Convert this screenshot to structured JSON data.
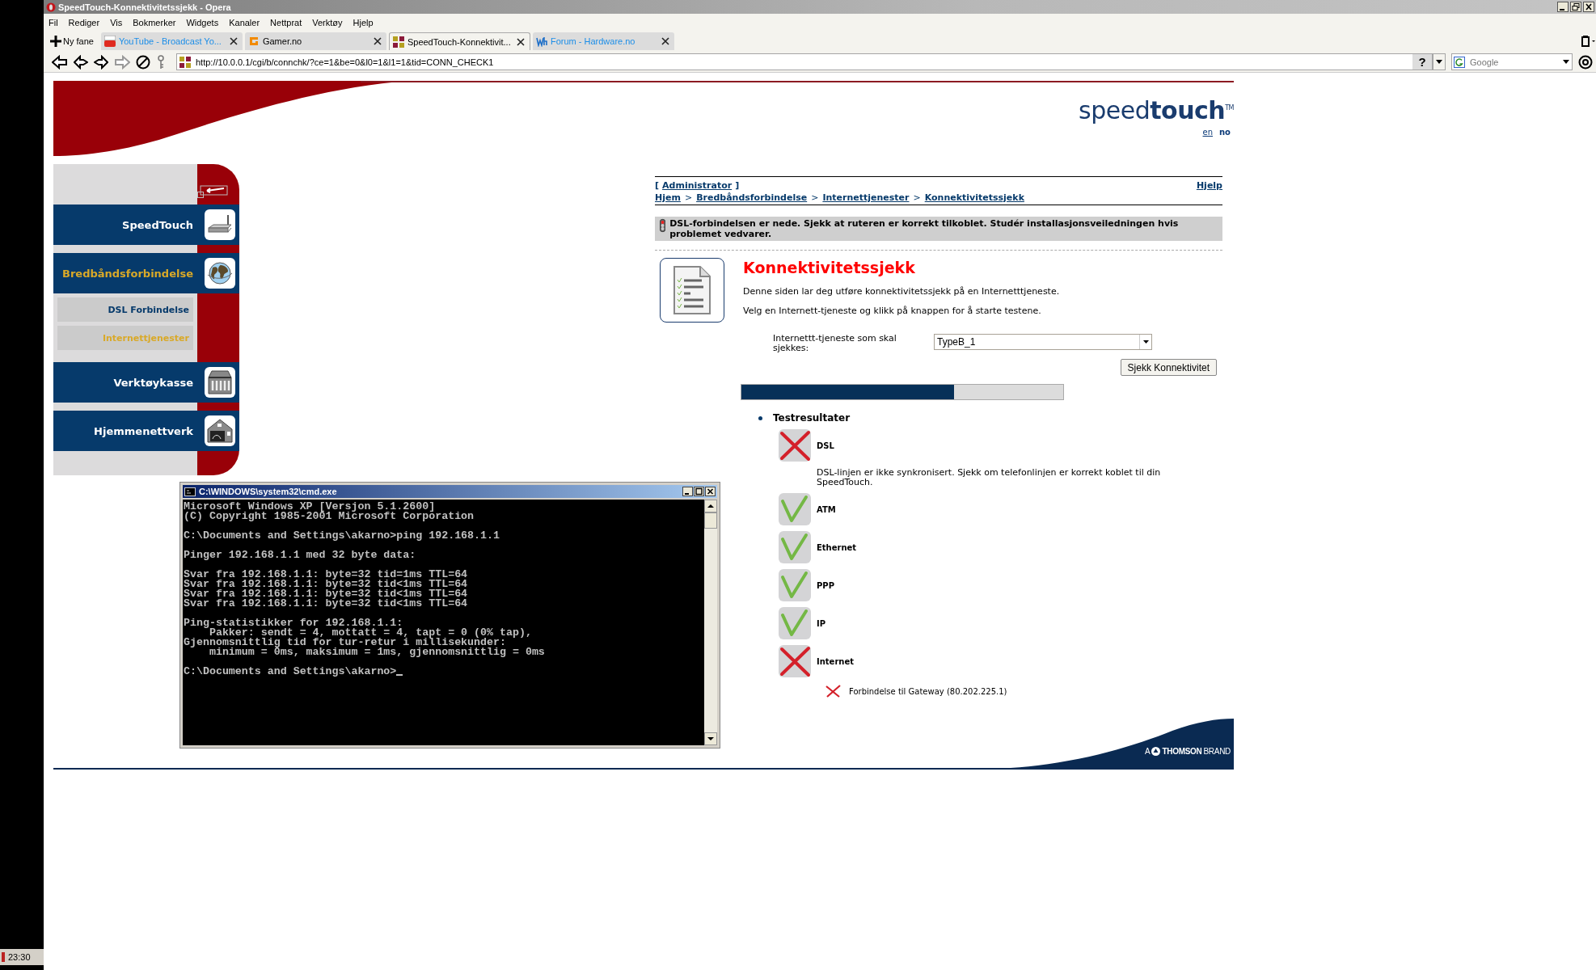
{
  "taskbar": {
    "clock": "23:30"
  },
  "window": {
    "title": "SpeedTouch-Konnektivitetssjekk - Opera"
  },
  "menu": [
    "Fil",
    "Rediger",
    "Vis",
    "Bokmerker",
    "Widgets",
    "Kanaler",
    "Nettprat",
    "Verktøy",
    "Hjelp"
  ],
  "new_tab": "Ny fane",
  "tabs": [
    {
      "label": "YouTube - Broadcast Yo...",
      "selected": false,
      "color": "#1c8ee8"
    },
    {
      "label": "Gamer.no",
      "selected": false,
      "color": "#000000"
    },
    {
      "label": "SpeedTouch-Konnektivit...",
      "selected": true,
      "color": "#000000"
    },
    {
      "label": "Forum - Hardware.no",
      "selected": false,
      "color": "#1c8ee8"
    }
  ],
  "address": {
    "url": "http://10.0.0.1/cgi/b/connchk/?ce=1&be=0&l0=1&l1=1&tid=CONN_CHECK1",
    "help": "?"
  },
  "search": {
    "placeholder": "Google"
  },
  "page": {
    "logo": "speed**touch**$^{TM}$",
    "languages": [
      {
        "label": "en",
        "selected": false
      },
      {
        "label": "no",
        "selected": true
      }
    ],
    "sidebar": {
      "items": [
        {
          "label": "SpeedTouch",
          "selected": false
        },
        {
          "label": "Bredbåndsforbindelse",
          "selected": true,
          "children": [
            {
              "label": "DSL Forbindelse",
              "selected": false
            },
            {
              "label": "Internettjenester",
              "selected": true
            }
          ]
        },
        {
          "label": "Verktøykasse",
          "selected": false
        },
        {
          "label": "Hjemmenettverk",
          "selected": false
        }
      ]
    },
    "account": {
      "open": "[",
      "name": "Administrator",
      "close": "]"
    },
    "help_link": "Hjelp",
    "breadcrumb": [
      {
        "label": "Hjem"
      },
      {
        "separator": ">",
        "label": "Bredbåndsforbindelse"
      },
      {
        "separator": ">",
        "label": "Internettjenester"
      },
      {
        "separator": ">",
        "label": "Konnektivitetssjekk"
      }
    ],
    "alert": "DSL-forbindelsen er nede. Sjekk at ruteren er korrekt tilkoblet. Studér installasjonsveiledningen hvis problemet vedvarer.",
    "title": "Konnektivitetssjekk",
    "intro": [
      "Denne siden lar deg utføre konnektivitetssjekk på en Internetttjeneste.",
      "Velg en Internett-tjeneste og klikk på knappen for å starte testene."
    ],
    "service_field": {
      "label": "Internettt-tjeneste som skal sjekkes:",
      "value": "TypeB_1"
    },
    "check_button": "Sjekk Konnektivitet",
    "progress": {
      "level": 0.66
    },
    "results": {
      "heading": "Testresultater",
      "items": [
        {
          "name": "DSL",
          "passed": false,
          "note": "DSL-linjen er ikke synkronisert. Sjekk om telefonlinjen er korrekt koblet til din SpeedTouch."
        },
        {
          "name": "ATM",
          "passed": true
        },
        {
          "name": "Ethernet",
          "passed": true
        },
        {
          "name": "PPP",
          "passed": true
        },
        {
          "name": "IP",
          "passed": true
        },
        {
          "name": "Internet",
          "passed": false,
          "children": [
            {
              "name": "Forbindelse til Gateway (80.202.225.1)",
              "passed": false
            }
          ]
        }
      ]
    },
    "brand": {
      "prefix": "A",
      "name": "THOMSON",
      "suffix": "BRAND"
    }
  },
  "console": {
    "title": "C:\\WINDOWS\\system32\\cmd.exe",
    "blocks": [
      [
        "Microsoft Windows XP [Versjon 5.1.2600]",
        "(C) Copyright 1985-2001 Microsoft Corporation"
      ],
      [
        "C:\\Documents and Settings\\akarno>ping 192.168.1.1"
      ],
      [
        "Pinger 192.168.1.1 med 32 byte data:"
      ],
      [
        "Svar fra 192.168.1.1: byte=32 tid=1ms TTL=64",
        "Svar fra 192.168.1.1: byte=32 tid<1ms TTL=64",
        "Svar fra 192.168.1.1: byte=32 tid<1ms TTL=64",
        "Svar fra 192.168.1.1: byte=32 tid<1ms TTL=64"
      ],
      [
        "Ping-statistikker for 192.168.1.1:",
        "    Pakker: sendt = 4, mottatt = 4, tapt = 0 (0% tap),",
        "Gjennomsnittlig tid for tur-retur i millisekunder:",
        "    minimum = 0ms, maksimum = 1ms, gjennomsnittlig = 0ms"
      ],
      [
        "C:\\Documents and Settings\\akarno>"
      ]
    ]
  }
}
